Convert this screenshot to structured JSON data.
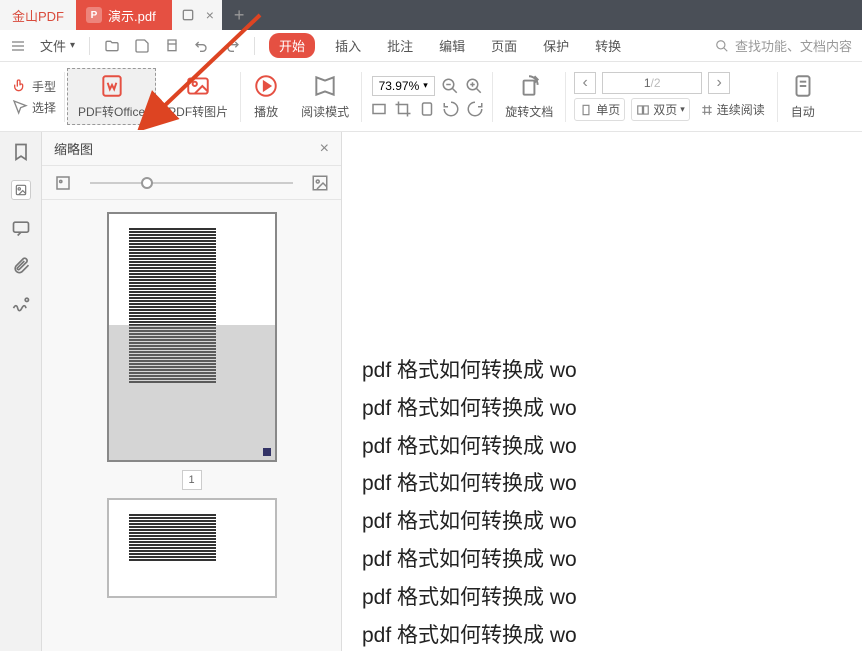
{
  "titlebar": {
    "app_name": "金山PDF",
    "tab_icon": "P",
    "tab_title": "演示.pdf",
    "new_tab": "+"
  },
  "menubar": {
    "file": "文件",
    "items": [
      "插入",
      "批注",
      "编辑",
      "页面",
      "保护",
      "转换"
    ],
    "active": "开始",
    "search_placeholder": "查找功能、文档内容"
  },
  "toolbar": {
    "hand": "手型",
    "select": "选择",
    "pdf_to_office": "PDF转Office",
    "pdf_to_image": "PDF转图片",
    "play": "播放",
    "read_mode": "阅读模式",
    "zoom": "73.97%",
    "rotate": "旋转文档",
    "single_page": "单页",
    "double_page": "双页",
    "continuous": "连续阅读",
    "auto_scroll": "自动",
    "page_current": "1",
    "page_total": "/2"
  },
  "thumb_panel": {
    "title": "缩略图",
    "page_num": "1"
  },
  "document": {
    "lines": [
      "pdf 格式如何转换成 wo",
      "pdf 格式如何转换成 wo",
      "pdf 格式如何转换成 wo",
      "pdf 格式如何转换成 wo",
      "pdf 格式如何转换成 wo",
      "pdf 格式如何转换成 wo",
      "pdf 格式如何转换成 wo",
      "pdf 格式如何转换成 wo"
    ]
  }
}
